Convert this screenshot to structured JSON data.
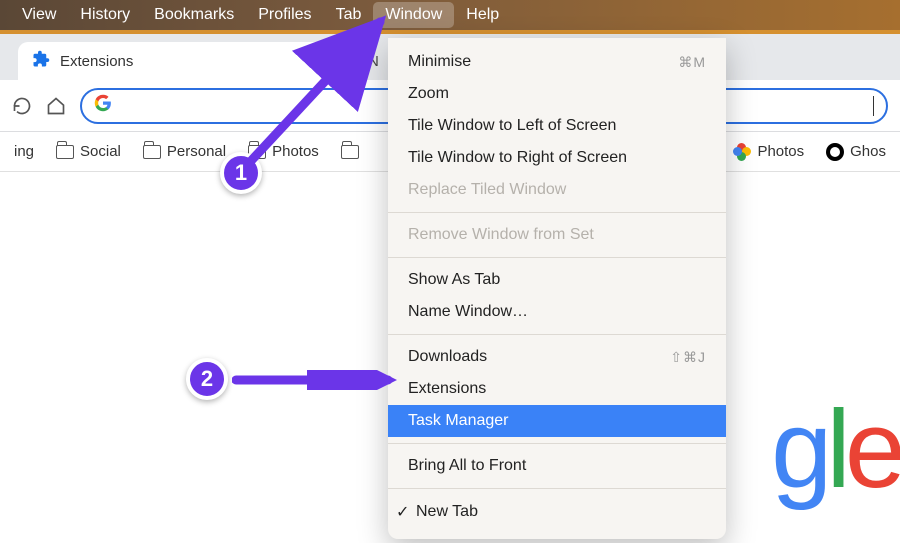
{
  "menubar": {
    "items": [
      "View",
      "History",
      "Bookmarks",
      "Profiles",
      "Tab",
      "Window",
      "Help"
    ],
    "active_index": 5
  },
  "tabs": {
    "active": {
      "title": "Extensions",
      "icon": "puzzle-piece"
    },
    "second": {
      "title": "N",
      "loading": true
    }
  },
  "toolbar": {
    "search_value": "",
    "search_placeholder": ""
  },
  "bookmarks": {
    "left_partial": "ing",
    "items": [
      {
        "label": "Social",
        "icon": "folder"
      },
      {
        "label": "Personal",
        "icon": "folder"
      },
      {
        "label": "Photos",
        "icon": "folder"
      }
    ],
    "right_items": [
      {
        "label": "Photos",
        "icon": "google-photos"
      },
      {
        "label": "Ghos",
        "icon": "ghostery"
      }
    ]
  },
  "dropdown": {
    "items": [
      {
        "label": "Minimise",
        "shortcut": "⌘M",
        "enabled": true
      },
      {
        "label": "Zoom",
        "enabled": true
      },
      {
        "label": "Tile Window to Left of Screen",
        "enabled": true
      },
      {
        "label": "Tile Window to Right of Screen",
        "enabled": true
      },
      {
        "label": "Replace Tiled Window",
        "enabled": false
      },
      {
        "type": "separator"
      },
      {
        "label": "Remove Window from Set",
        "enabled": false
      },
      {
        "type": "separator"
      },
      {
        "label": "Show As Tab",
        "enabled": true
      },
      {
        "label": "Name Window…",
        "enabled": true
      },
      {
        "type": "separator"
      },
      {
        "label": "Downloads",
        "shortcut": "⇧⌘J",
        "enabled": true
      },
      {
        "label": "Extensions",
        "enabled": true
      },
      {
        "label": "Task Manager",
        "enabled": true,
        "highlight": true
      },
      {
        "type": "separator"
      },
      {
        "label": "Bring All to Front",
        "enabled": true
      },
      {
        "type": "separator"
      },
      {
        "label": "New Tab",
        "enabled": true,
        "checked": true
      }
    ]
  },
  "annotations": {
    "badge1": "1",
    "badge2": "2"
  },
  "logo": {
    "g": "g",
    "l": "l",
    "e": "e"
  }
}
